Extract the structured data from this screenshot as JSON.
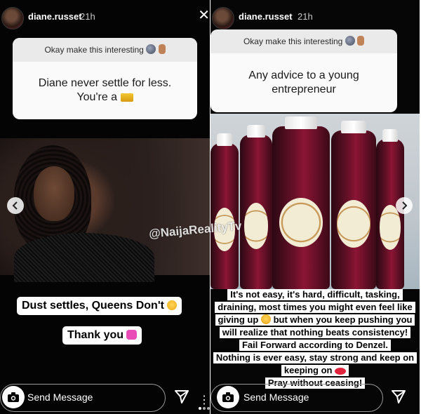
{
  "left_story": {
    "username": "diane.russet",
    "time": "21h",
    "question_prompt": "Okay make this interesting",
    "question": "Diane never settle for less. You're a",
    "answer_sticker_1": "Dust settles, Queens Don't",
    "answer_sticker_2": "Thank you",
    "message_placeholder": "Send Message"
  },
  "right_story": {
    "username": "diane.russet",
    "time": "21h",
    "question_prompt": "Okay make this interesting",
    "question": "Any advice to a young entrepreneur",
    "answer_lines": [
      "It's not easy, it's hard, difficult, tasking,",
      "draining, most times you might even feel like",
      "giving up",
      "but when you keep pushing you",
      "will realize that nothing beats consistency!",
      "Fail Forward according to Denzel.",
      "Nothing is ever easy, stay strong and keep on",
      "keeping on",
      "Pray without ceasing!"
    ],
    "message_placeholder": "Send Message"
  },
  "watermark": "@NaijaRealityTv",
  "icons": {
    "close": "close-icon",
    "camera": "camera-icon",
    "send": "send-icon",
    "prev": "chevron-left-icon",
    "next": "chevron-right-icon",
    "more": "more-icon"
  },
  "colors": {
    "story_bg": "#050505",
    "card_bg": "#fafafa",
    "card_header_bg": "#eaeaea",
    "text_light": "#ffffff"
  }
}
